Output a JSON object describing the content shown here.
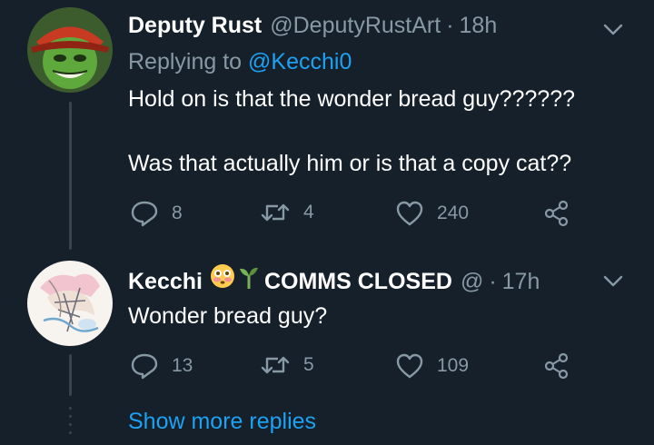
{
  "tweets": [
    {
      "name": "Deputy Rust",
      "handle": "@DeputyRustArt",
      "separator": "·",
      "time": "18h",
      "replying_prefix": "Replying to",
      "replying_to": "@Kecchi0",
      "body_line1": "Hold on is that the wonder bread guy??????",
      "body_line2": "Was that actually him or is that a copy cat??",
      "reply_count": "8",
      "retweet_count": "4",
      "like_count": "240",
      "avatar_icon": "green-masked-character-avatar"
    },
    {
      "name": "Kecchi",
      "name_suffix": "COMMS CLOSED",
      "handle": "@",
      "separator": "·",
      "time": "17h",
      "body_line1": "Wonder bread guy?",
      "reply_count": "13",
      "retweet_count": "5",
      "like_count": "109",
      "avatar_icon": "anime-sketch-avatar"
    }
  ],
  "show_more": "Show more replies",
  "colors": {
    "background": "#15202b",
    "secondary_text": "#8899a6",
    "link": "#1da1f2",
    "thread_line": "#38444d"
  },
  "icons": [
    "reply-icon",
    "retweet-icon",
    "like-icon",
    "share-icon",
    "chevron-down-icon",
    "flushed-face-emoji",
    "seedling-emoji"
  ]
}
